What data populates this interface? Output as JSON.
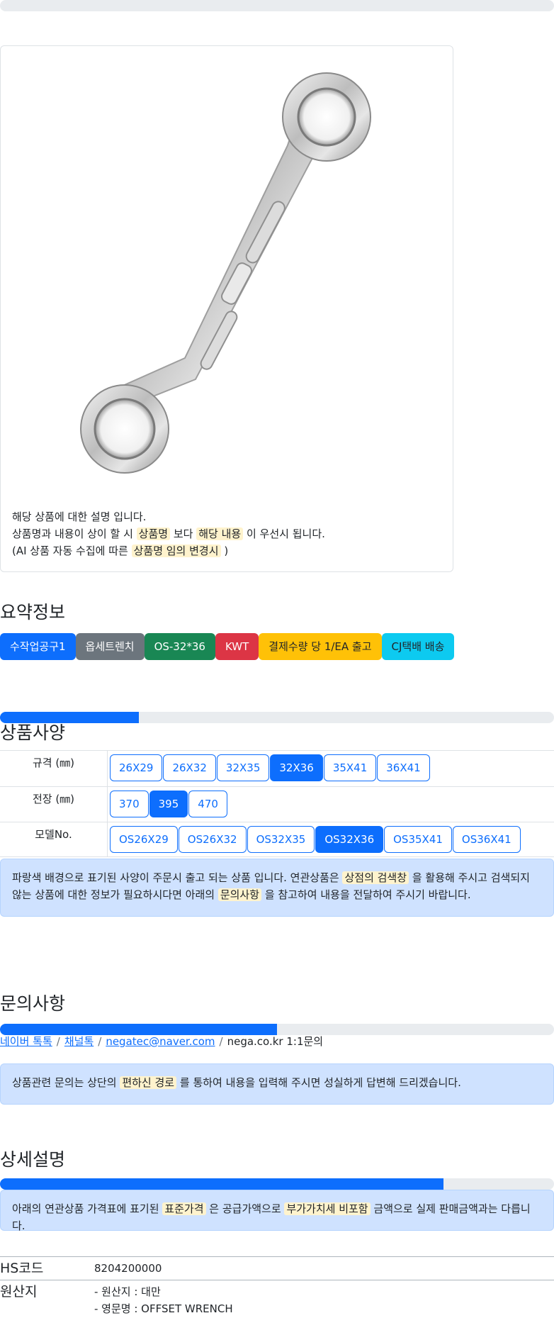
{
  "image_note": {
    "line1": "해당 상품에 대한 설명 입니다.",
    "line2_pre": "상품명과 내용이 상이 할 시",
    "line2_hl1": "상품명",
    "line2_mid": "보다",
    "line2_hl2": "해당 내용",
    "line2_post": "이 우선시 됩니다.",
    "line3_pre": "(AI 상품 자동 수집에 따른",
    "line3_hl": "상품명 임의 변경시",
    "line3_post": ")"
  },
  "summary": {
    "title": "요약정보",
    "badges": [
      "수작업공구1",
      "옵세트렌치",
      "OS-32*36",
      "KWT",
      "결제수량 당 1/EA 출고",
      "CJ택배 배송"
    ]
  },
  "specs": {
    "title": "상품사양",
    "progress_percent": 25,
    "rows": [
      {
        "label": "규격 (㎜)",
        "options": [
          "26X29",
          "26X32",
          "32X35",
          "32X36",
          "35X41",
          "36X41"
        ],
        "selected": "32X36"
      },
      {
        "label": "전장 (㎜)",
        "options": [
          "370",
          "395",
          "470"
        ],
        "selected": "395"
      },
      {
        "label": "모델No.",
        "options": [
          "OS26X29",
          "OS26X32",
          "OS32X35",
          "OS32X36",
          "OS35X41",
          "OS36X41"
        ],
        "selected": "OS32X36"
      }
    ],
    "alert_pre": "파랑색 배경으로 표기된 사양이 주문시 출고 되는 상품 입니다. 연관상품은",
    "alert_hl1": "상점의 검색창",
    "alert_mid": "을 활용해 주시고 검색되지 않는 상품에 대한 정보가 필요하시다면 아래의",
    "alert_hl2": "문의사항",
    "alert_post": "을 참고하여 내용을 전달하여 주시기 바랍니다."
  },
  "inquiry": {
    "title": "문의사항",
    "progress_percent": 50,
    "links": [
      "네이버 톡톡",
      "채널톡",
      "negatec@naver.com"
    ],
    "last": "nega.co.kr 1:1문의",
    "alert_pre": "상품관련 문의는 상단의",
    "alert_hl": "편하신 경로",
    "alert_post": "를 통하여 내용을 입력해 주시면 성실하게 답변해 드리겠습니다."
  },
  "detail": {
    "title": "상세설명",
    "progress_percent": 80,
    "alert_pre": "아래의 연관상품 가격표에 표기된",
    "alert_hl1": "표준가격",
    "alert_mid": "은 공급가액으로",
    "alert_hl2": "부가가치세 비포함",
    "alert_post": "금액으로 실제 판매금액과는 다릅니다."
  },
  "info": {
    "hs_label": "HS코드",
    "hs_value": "8204200000",
    "origin_label": "원산지",
    "origin_line1": "- 원산지 : 대만",
    "origin_line2": "- 영문명 : OFFSET WRENCH"
  },
  "colors": {
    "primary": "#0d6efd",
    "highlight": "#fff3cd",
    "alert_bg": "#cfe2ff"
  }
}
